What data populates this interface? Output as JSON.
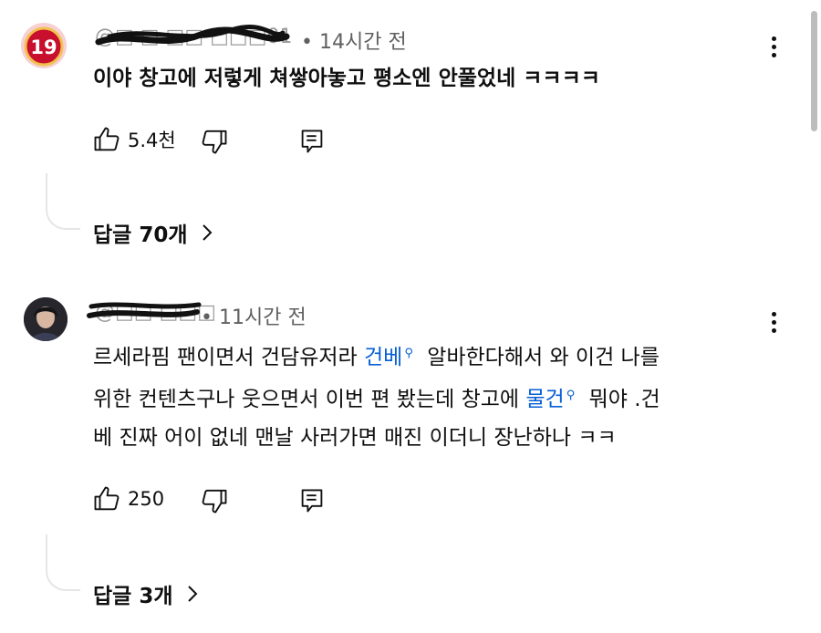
{
  "comments": [
    {
      "handle": "@□ □ □□ □□□01",
      "time": "14시간 전",
      "text_lines": [
        "이야 창고에 저렇게 쳐쌓아놓고 평소엔 안풀었네 ㅋㅋㅋㅋ"
      ],
      "likes": "5.4천",
      "replies_label": "답글 70개",
      "avatar_badge": "19",
      "avatar_color": "#c8102e"
    },
    {
      "handle": "@□□ □□□",
      "time": "11시간 전",
      "line1_a": "르세라핌 팬이면서 건담유저라",
      "line1_link": "건베",
      "line1_b": "알바한다해서 와 이건 나를",
      "line2_a": "위한 컨텐츠구나 웃으면서 이번 편 봤는데 창고에",
      "line2_link": "물건",
      "line2_b": "뭐야 .건",
      "line3": "베 진짜 어이 없네 맨날 사러가면 매진 이더니 장난하나 ㅋㅋ",
      "likes": "250",
      "replies_label": "답글 3개"
    }
  ],
  "colors": {
    "link": "#065fd4",
    "meta": "#606060",
    "text": "#0f0f0f"
  },
  "icons": [
    "thumbs-up-icon",
    "thumbs-down-icon",
    "reply-icon",
    "more-vert-icon",
    "chevron-right-icon",
    "search-icon"
  ]
}
